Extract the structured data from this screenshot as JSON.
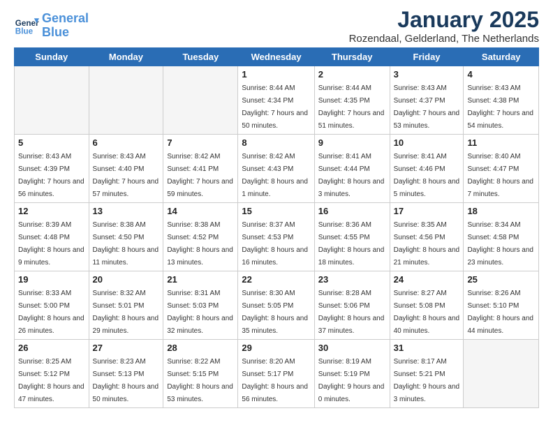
{
  "header": {
    "logo_line1": "General",
    "logo_line2": "Blue",
    "month_title": "January 2025",
    "subtitle": "Rozendaal, Gelderland, The Netherlands"
  },
  "days_of_week": [
    "Sunday",
    "Monday",
    "Tuesday",
    "Wednesday",
    "Thursday",
    "Friday",
    "Saturday"
  ],
  "weeks": [
    [
      {
        "day": "",
        "sunrise": "",
        "sunset": "",
        "daylight": "",
        "empty": true
      },
      {
        "day": "",
        "sunrise": "",
        "sunset": "",
        "daylight": "",
        "empty": true
      },
      {
        "day": "",
        "sunrise": "",
        "sunset": "",
        "daylight": "",
        "empty": true
      },
      {
        "day": "1",
        "sunrise": "Sunrise: 8:44 AM",
        "sunset": "Sunset: 4:34 PM",
        "daylight": "Daylight: 7 hours and 50 minutes."
      },
      {
        "day": "2",
        "sunrise": "Sunrise: 8:44 AM",
        "sunset": "Sunset: 4:35 PM",
        "daylight": "Daylight: 7 hours and 51 minutes."
      },
      {
        "day": "3",
        "sunrise": "Sunrise: 8:43 AM",
        "sunset": "Sunset: 4:37 PM",
        "daylight": "Daylight: 7 hours and 53 minutes."
      },
      {
        "day": "4",
        "sunrise": "Sunrise: 8:43 AM",
        "sunset": "Sunset: 4:38 PM",
        "daylight": "Daylight: 7 hours and 54 minutes."
      }
    ],
    [
      {
        "day": "5",
        "sunrise": "Sunrise: 8:43 AM",
        "sunset": "Sunset: 4:39 PM",
        "daylight": "Daylight: 7 hours and 56 minutes."
      },
      {
        "day": "6",
        "sunrise": "Sunrise: 8:43 AM",
        "sunset": "Sunset: 4:40 PM",
        "daylight": "Daylight: 7 hours and 57 minutes."
      },
      {
        "day": "7",
        "sunrise": "Sunrise: 8:42 AM",
        "sunset": "Sunset: 4:41 PM",
        "daylight": "Daylight: 7 hours and 59 minutes."
      },
      {
        "day": "8",
        "sunrise": "Sunrise: 8:42 AM",
        "sunset": "Sunset: 4:43 PM",
        "daylight": "Daylight: 8 hours and 1 minute."
      },
      {
        "day": "9",
        "sunrise": "Sunrise: 8:41 AM",
        "sunset": "Sunset: 4:44 PM",
        "daylight": "Daylight: 8 hours and 3 minutes."
      },
      {
        "day": "10",
        "sunrise": "Sunrise: 8:41 AM",
        "sunset": "Sunset: 4:46 PM",
        "daylight": "Daylight: 8 hours and 5 minutes."
      },
      {
        "day": "11",
        "sunrise": "Sunrise: 8:40 AM",
        "sunset": "Sunset: 4:47 PM",
        "daylight": "Daylight: 8 hours and 7 minutes."
      }
    ],
    [
      {
        "day": "12",
        "sunrise": "Sunrise: 8:39 AM",
        "sunset": "Sunset: 4:48 PM",
        "daylight": "Daylight: 8 hours and 9 minutes."
      },
      {
        "day": "13",
        "sunrise": "Sunrise: 8:38 AM",
        "sunset": "Sunset: 4:50 PM",
        "daylight": "Daylight: 8 hours and 11 minutes."
      },
      {
        "day": "14",
        "sunrise": "Sunrise: 8:38 AM",
        "sunset": "Sunset: 4:52 PM",
        "daylight": "Daylight: 8 hours and 13 minutes."
      },
      {
        "day": "15",
        "sunrise": "Sunrise: 8:37 AM",
        "sunset": "Sunset: 4:53 PM",
        "daylight": "Daylight: 8 hours and 16 minutes."
      },
      {
        "day": "16",
        "sunrise": "Sunrise: 8:36 AM",
        "sunset": "Sunset: 4:55 PM",
        "daylight": "Daylight: 8 hours and 18 minutes."
      },
      {
        "day": "17",
        "sunrise": "Sunrise: 8:35 AM",
        "sunset": "Sunset: 4:56 PM",
        "daylight": "Daylight: 8 hours and 21 minutes."
      },
      {
        "day": "18",
        "sunrise": "Sunrise: 8:34 AM",
        "sunset": "Sunset: 4:58 PM",
        "daylight": "Daylight: 8 hours and 23 minutes."
      }
    ],
    [
      {
        "day": "19",
        "sunrise": "Sunrise: 8:33 AM",
        "sunset": "Sunset: 5:00 PM",
        "daylight": "Daylight: 8 hours and 26 minutes."
      },
      {
        "day": "20",
        "sunrise": "Sunrise: 8:32 AM",
        "sunset": "Sunset: 5:01 PM",
        "daylight": "Daylight: 8 hours and 29 minutes."
      },
      {
        "day": "21",
        "sunrise": "Sunrise: 8:31 AM",
        "sunset": "Sunset: 5:03 PM",
        "daylight": "Daylight: 8 hours and 32 minutes."
      },
      {
        "day": "22",
        "sunrise": "Sunrise: 8:30 AM",
        "sunset": "Sunset: 5:05 PM",
        "daylight": "Daylight: 8 hours and 35 minutes."
      },
      {
        "day": "23",
        "sunrise": "Sunrise: 8:28 AM",
        "sunset": "Sunset: 5:06 PM",
        "daylight": "Daylight: 8 hours and 37 minutes."
      },
      {
        "day": "24",
        "sunrise": "Sunrise: 8:27 AM",
        "sunset": "Sunset: 5:08 PM",
        "daylight": "Daylight: 8 hours and 40 minutes."
      },
      {
        "day": "25",
        "sunrise": "Sunrise: 8:26 AM",
        "sunset": "Sunset: 5:10 PM",
        "daylight": "Daylight: 8 hours and 44 minutes."
      }
    ],
    [
      {
        "day": "26",
        "sunrise": "Sunrise: 8:25 AM",
        "sunset": "Sunset: 5:12 PM",
        "daylight": "Daylight: 8 hours and 47 minutes."
      },
      {
        "day": "27",
        "sunrise": "Sunrise: 8:23 AM",
        "sunset": "Sunset: 5:13 PM",
        "daylight": "Daylight: 8 hours and 50 minutes."
      },
      {
        "day": "28",
        "sunrise": "Sunrise: 8:22 AM",
        "sunset": "Sunset: 5:15 PM",
        "daylight": "Daylight: 8 hours and 53 minutes."
      },
      {
        "day": "29",
        "sunrise": "Sunrise: 8:20 AM",
        "sunset": "Sunset: 5:17 PM",
        "daylight": "Daylight: 8 hours and 56 minutes."
      },
      {
        "day": "30",
        "sunrise": "Sunrise: 8:19 AM",
        "sunset": "Sunset: 5:19 PM",
        "daylight": "Daylight: 9 hours and 0 minutes."
      },
      {
        "day": "31",
        "sunrise": "Sunrise: 8:17 AM",
        "sunset": "Sunset: 5:21 PM",
        "daylight": "Daylight: 9 hours and 3 minutes."
      },
      {
        "day": "",
        "sunrise": "",
        "sunset": "",
        "daylight": "",
        "empty": true
      }
    ]
  ]
}
